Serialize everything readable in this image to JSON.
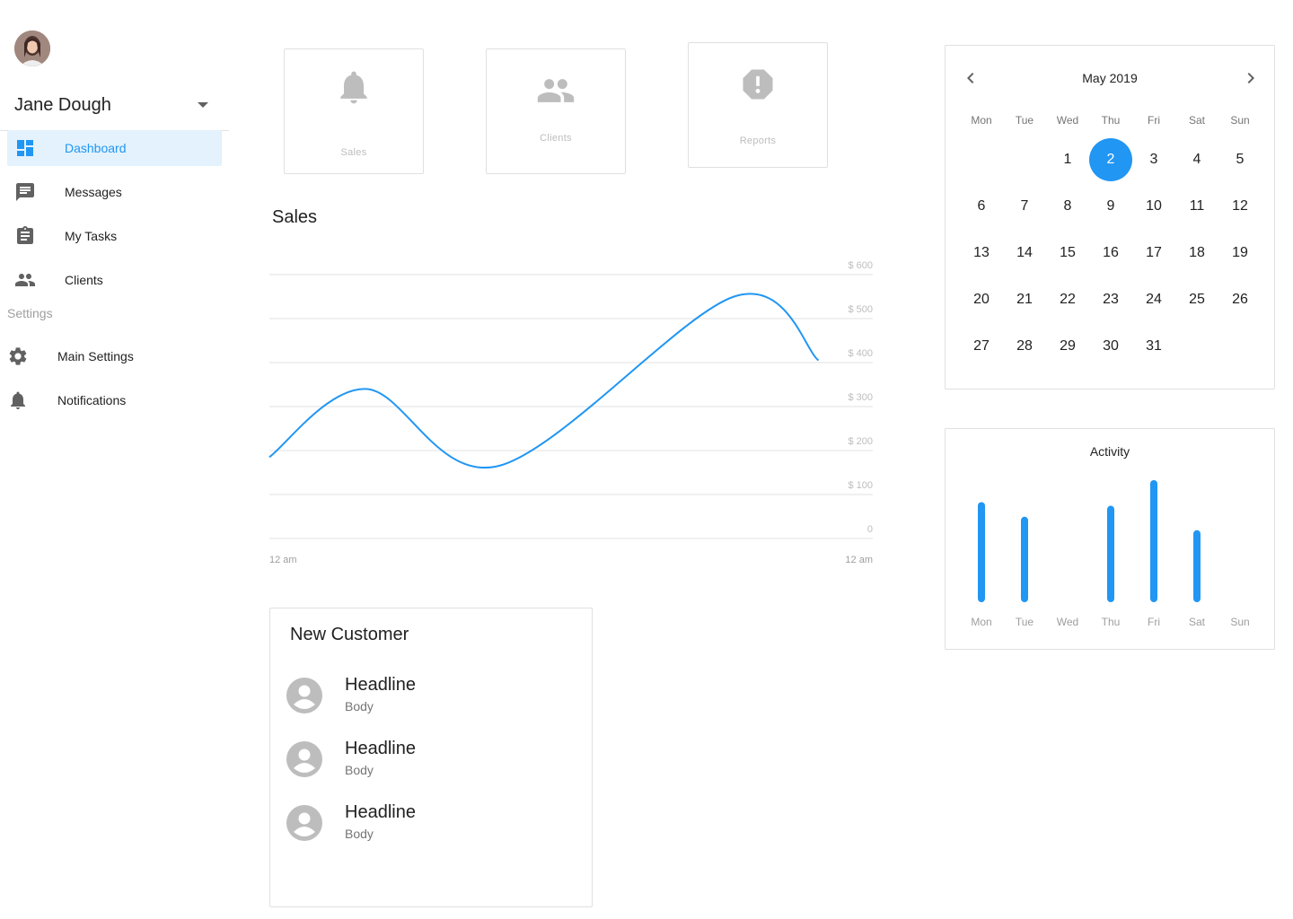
{
  "user": {
    "name": "Jane Dough"
  },
  "sidebar": {
    "items": [
      {
        "label": "Dashboard",
        "icon": "dashboard-icon",
        "active": true
      },
      {
        "label": "Messages",
        "icon": "message-icon"
      },
      {
        "label": "My Tasks",
        "icon": "clipboard-icon"
      },
      {
        "label": "Clients",
        "icon": "people-icon"
      }
    ],
    "section_label": "Settings",
    "settings_items": [
      {
        "label": "Main Settings",
        "icon": "gear-icon"
      },
      {
        "label": "Notifications",
        "icon": "bell-icon"
      }
    ]
  },
  "stat_cards": [
    {
      "label": "Sales",
      "icon": "bell-icon"
    },
    {
      "label": "Clients",
      "icon": "people-icon"
    },
    {
      "label": "Reports",
      "icon": "alert-octagon-icon"
    }
  ],
  "sales": {
    "title": "Sales"
  },
  "chart_data": [
    {
      "type": "line",
      "title": "Sales",
      "y_ticks": [
        "$ 600",
        "$ 500",
        "$ 400",
        "$ 300",
        "$ 200",
        "$ 100",
        "0"
      ],
      "x_tick_labels": [
        "12 am",
        "12 am"
      ],
      "ylim": [
        0,
        600
      ],
      "x": [
        0,
        0.16,
        0.38,
        0.77,
        0.91
      ],
      "values": [
        185,
        340,
        165,
        550,
        405
      ],
      "color": "#2196f3",
      "grid": true
    },
    {
      "type": "bar",
      "title": "Activity",
      "categories": [
        "Mon",
        "Tue",
        "Wed",
        "Thu",
        "Fri",
        "Sat",
        "Sun"
      ],
      "values": [
        0.82,
        0.7,
        0,
        0.79,
        1.0,
        0.59,
        0
      ],
      "color": "#2196f3"
    }
  ],
  "customers": {
    "title": "New Customer",
    "items": [
      {
        "headline": "Headline",
        "body": "Body"
      },
      {
        "headline": "Headline",
        "body": "Body"
      },
      {
        "headline": "Headline",
        "body": "Body"
      }
    ]
  },
  "calendar": {
    "month_label": "May 2019",
    "weekdays": [
      "Mon",
      "Tue",
      "Wed",
      "Thu",
      "Fri",
      "Sat",
      "Sun"
    ],
    "first_weekday_index": 2,
    "days_in_month": 31,
    "selected_day": 2,
    "accent": "#2196f3"
  },
  "activity": {
    "title": "Activity"
  },
  "colors": {
    "accent": "#2196f3",
    "active_bg": "#e3f2fd",
    "icon_gray": "#bdbdbd"
  }
}
